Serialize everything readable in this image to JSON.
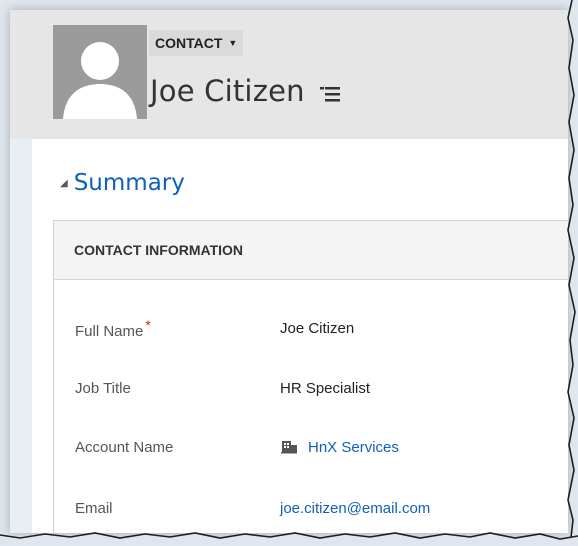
{
  "header": {
    "entity_type": "CONTACT",
    "record_name": "Joe Citizen"
  },
  "summary": {
    "title": "Summary"
  },
  "contact_information": {
    "section_title": "CONTACT INFORMATION",
    "fields": [
      {
        "label": "Full Name",
        "required_marker": "*",
        "value": "Joe Citizen"
      },
      {
        "label": "Job Title",
        "value": "HR Specialist"
      },
      {
        "label": "Account Name",
        "value": "HnX Services"
      },
      {
        "label": "Email",
        "value": "joe.citizen@email.com"
      }
    ]
  },
  "icons": {
    "avatar": "person-avatar-icon",
    "entity_caret": "caret-down-icon",
    "record_menu": "menu-icon",
    "summary_toggle": "triangle-collapse-icon",
    "account": "account-icon"
  },
  "colors": {
    "link": "#1160b7",
    "required": "#d11c1c",
    "header_bg": "#e6e6e6"
  }
}
